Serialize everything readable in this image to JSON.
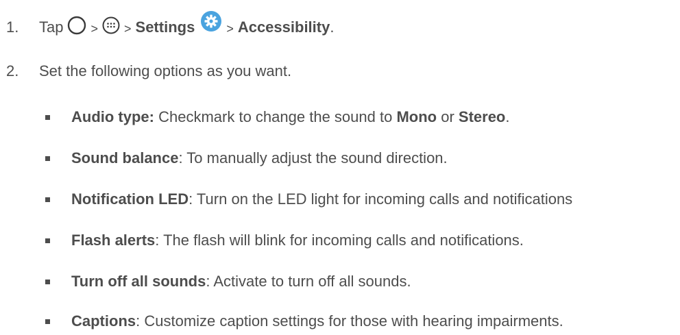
{
  "steps": [
    {
      "number": "1.",
      "tap": "Tap",
      "separator": ">",
      "settings": "Settings",
      "accessibility": "Accessibility",
      "period": ".",
      "icons": [
        "home-circle-icon",
        "apps-grid-icon",
        "settings-gear-icon"
      ]
    },
    {
      "number": "2.",
      "text": "Set the following options as you want."
    }
  ],
  "options": [
    {
      "term": "Audio type:",
      "desc_before": " Checkmark to change the sound to ",
      "bold1": "Mono",
      "mid": " or ",
      "bold2": "Stereo",
      "end": "."
    },
    {
      "term": "Sound balance",
      "desc": ": To manually adjust the sound direction."
    },
    {
      "term": "Notification LED",
      "desc": ": Turn on the LED light for incoming calls and notifications"
    },
    {
      "term": "Flash alerts",
      "desc": ": The flash will blink for incoming calls and notifications."
    },
    {
      "term": "Turn off all sounds",
      "desc": ": Activate to turn off all sounds."
    },
    {
      "term": "Captions",
      "desc": ": Customize caption settings for those with hearing impairments."
    }
  ],
  "colors": {
    "text": "#4d4d4d",
    "gear_icon_bg": "#4aa3df"
  }
}
